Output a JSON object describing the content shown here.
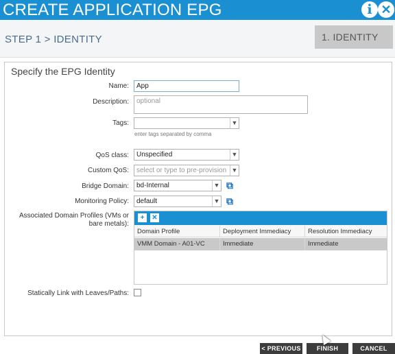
{
  "header": {
    "title": "CREATE APPLICATION EPG",
    "info_icon": "i",
    "close_icon": "✕"
  },
  "step": {
    "breadcrumb": "STEP 1 > IDENTITY",
    "badge": "1. IDENTITY"
  },
  "form": {
    "section_title": "Specify the EPG Identity",
    "name": {
      "label": "Name:",
      "value": "App"
    },
    "description": {
      "label": "Description:",
      "placeholder": "optional"
    },
    "tags": {
      "label": "Tags:",
      "hint": "enter tags separated by comma"
    },
    "qos_class": {
      "label": "QoS class:",
      "value": "Unspecified"
    },
    "custom_qos": {
      "label": "Custom QoS:",
      "placeholder": "select or type to pre-provision"
    },
    "bridge_domain": {
      "label": "Bridge Domain:",
      "value": "bd-Internal"
    },
    "monitoring_policy": {
      "label": "Monitoring Policy:",
      "value": "default"
    },
    "domain_profiles": {
      "label_line1": "Associated Domain Profiles (VMs or",
      "label_line2": "bare metals):",
      "columns": [
        "Domain Profile",
        "Deployment Immediacy",
        "Resolution Immediacy"
      ],
      "rows": [
        [
          "VMM Domain - A01-VC",
          "Immediate",
          "Immediate"
        ]
      ]
    },
    "static_link": {
      "label": "Statically Link with Leaves/Paths:",
      "checked": false
    }
  },
  "footer": {
    "previous_label": "< PREVIOUS",
    "finish_label": "FINISH",
    "cancel_label": "CANCEL"
  },
  "colors": {
    "accent": "#1a8fd1",
    "button_dark": "#3c3c3c",
    "selected_row": "#c9c9c9"
  }
}
